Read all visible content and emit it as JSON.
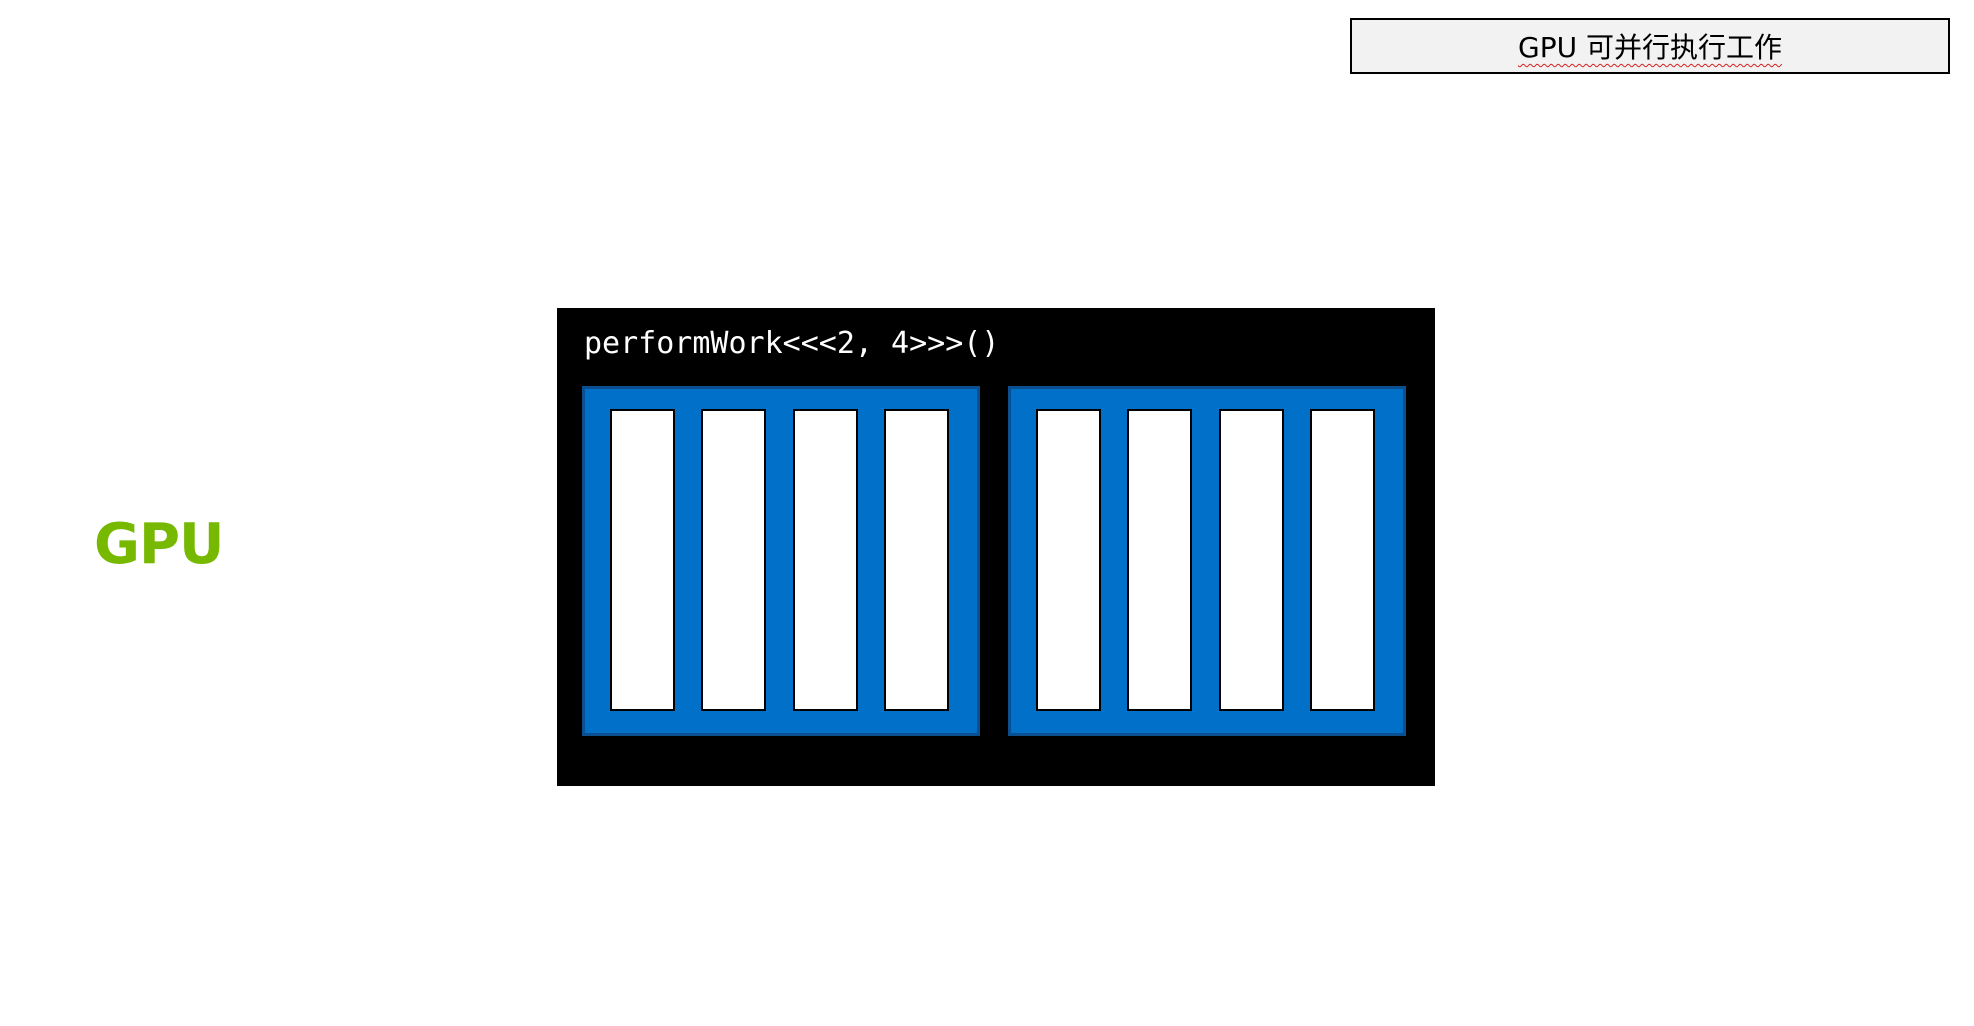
{
  "caption": "GPU 可并行执行工作",
  "side_label": "GPU",
  "kernel_call": "performWork<<<2, 4>>>()",
  "colors": {
    "panel_background": "#000000",
    "block_fill": "#0070c8",
    "thread_fill": "#ffffff",
    "label_green": "#76b900"
  },
  "grid": {
    "blocks": 2,
    "threads_per_block": 4
  }
}
